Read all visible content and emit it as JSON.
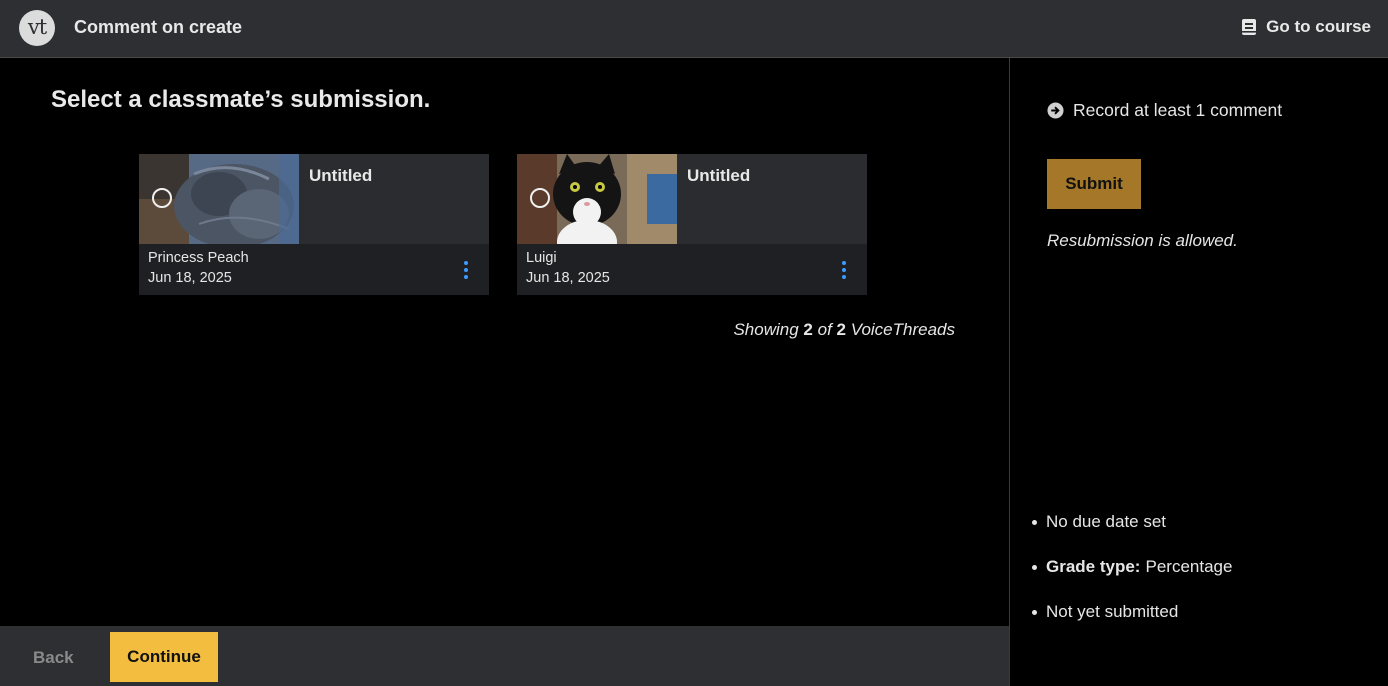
{
  "header": {
    "logo_text": "vt",
    "title": "Comment on create",
    "go_to_course": "Go to course"
  },
  "main": {
    "heading": "Select a classmate’s submission.",
    "cards": [
      {
        "title": "Untitled",
        "author": "Princess Peach",
        "date": "Jun 18, 2025",
        "thumbnail": "gray-cat-photo"
      },
      {
        "title": "Untitled",
        "author": "Luigi",
        "date": "Jun 18, 2025",
        "thumbnail": "tuxedo-cat-photo"
      }
    ],
    "showing": {
      "prefix": "Showing",
      "count": "2",
      "of": "of",
      "total": "2",
      "suffix": "VoiceThreads"
    }
  },
  "footer": {
    "back": "Back",
    "continue": "Continue"
  },
  "sidebar": {
    "requirement": "Record at least 1 comment",
    "submit": "Submit",
    "resubmission": "Resubmission is allowed.",
    "due": "No due date set",
    "grade_label": "Grade type:",
    "grade_value": "Percentage",
    "status": "Not yet submitted"
  },
  "colors": {
    "accent": "#f3bd3f",
    "submit": "#a47828",
    "link_blue": "#3d9bff",
    "bar": "#2e2f33"
  }
}
